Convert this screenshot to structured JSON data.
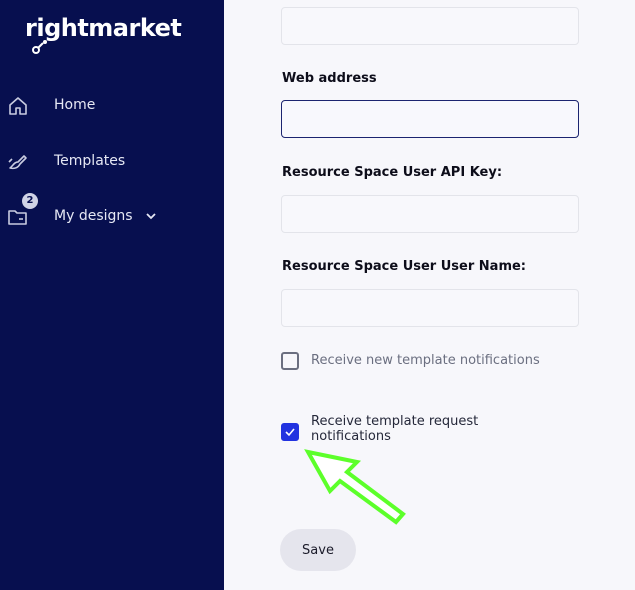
{
  "brand": {
    "logo_text": "rightmarket"
  },
  "sidebar": {
    "items": [
      {
        "label": "Home",
        "icon": "home-icon"
      },
      {
        "label": "Templates",
        "icon": "pen-icon"
      },
      {
        "label": "My designs",
        "icon": "folder-icon",
        "badge": "2"
      }
    ]
  },
  "form": {
    "web_address": {
      "label": "Web address",
      "value": ""
    },
    "api_key": {
      "label": "Resource Space User API Key:",
      "value": ""
    },
    "user_name": {
      "label": "Resource Space User User Name:",
      "value": ""
    },
    "notif_new_template": {
      "label": "Receive new template notifications",
      "checked": false
    },
    "notif_template_request": {
      "label_line1": "Receive template request",
      "label_line2": "notifications",
      "checked": true
    },
    "save_label": "Save"
  },
  "colors": {
    "sidebar_bg": "#070f4f",
    "accent": "#2233e0",
    "annotation_arrow": "#5cff2a"
  }
}
